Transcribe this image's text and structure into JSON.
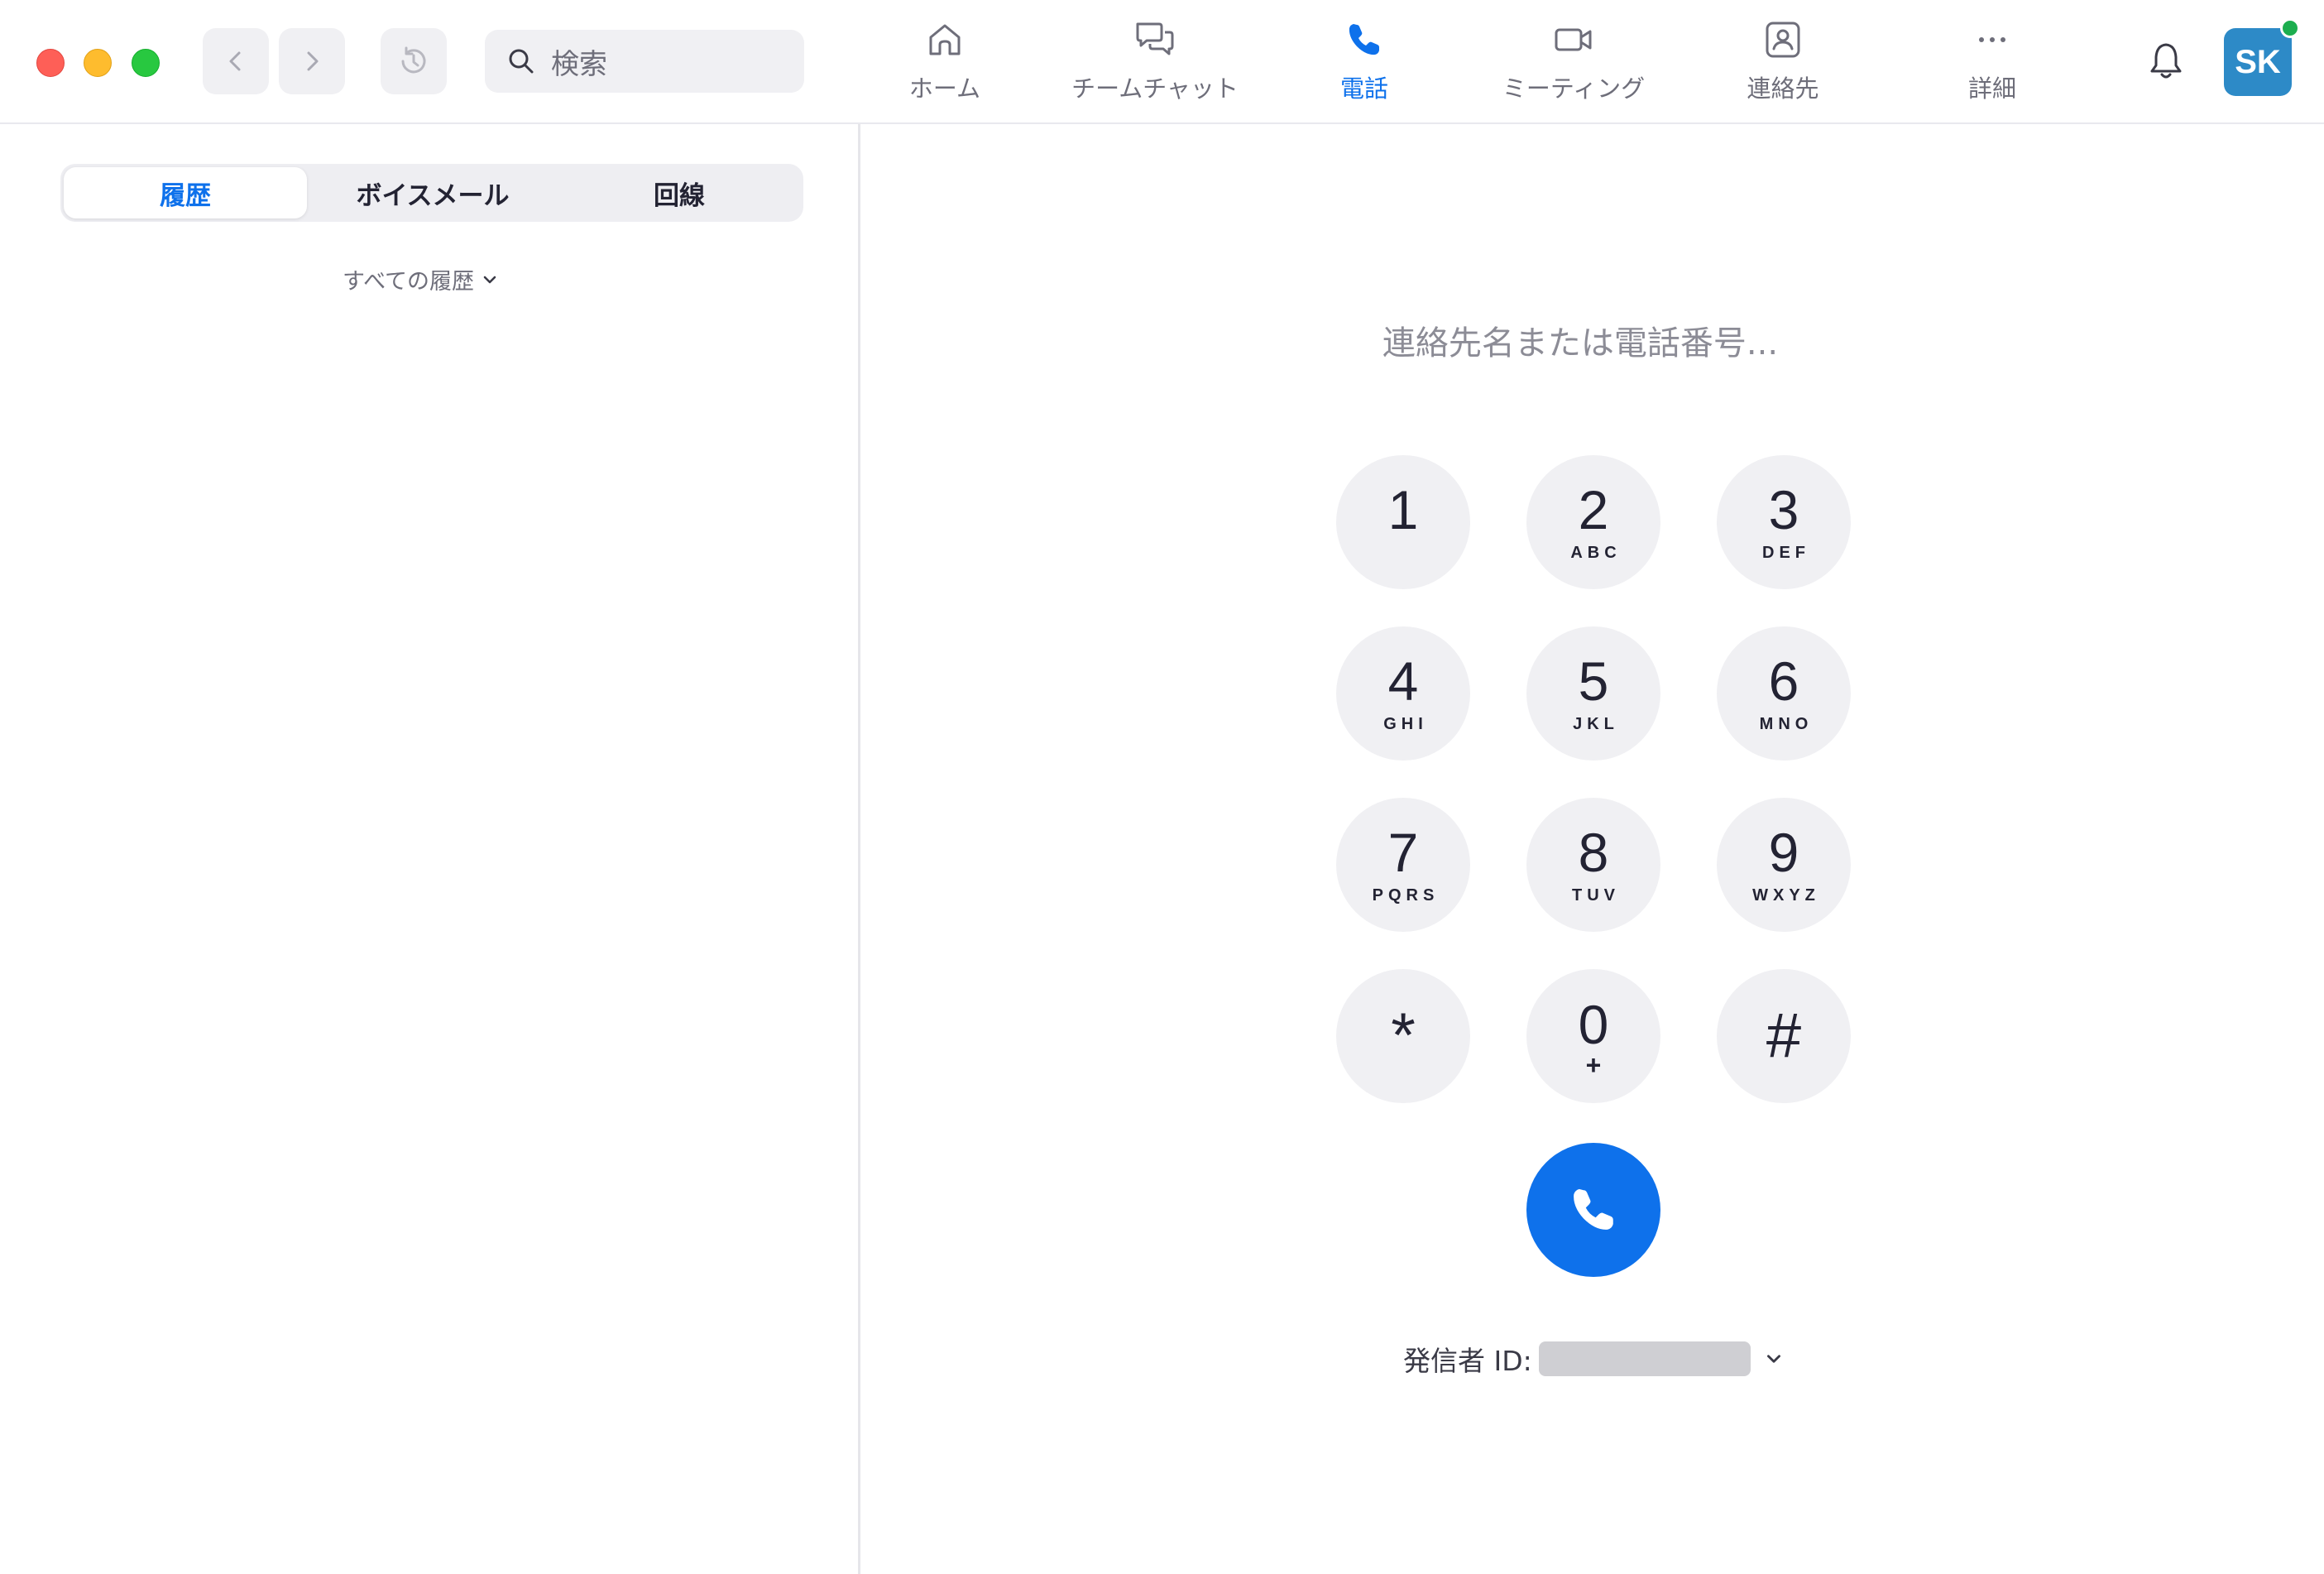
{
  "search": {
    "placeholder": "検索",
    "icon": "search-icon"
  },
  "tabs": [
    {
      "label": "ホーム",
      "icon": "home-icon",
      "active": false
    },
    {
      "label": "チームチャット",
      "icon": "chat-icon",
      "active": false
    },
    {
      "label": "電話",
      "icon": "phone-icon",
      "active": true
    },
    {
      "label": "ミーティング",
      "icon": "video-icon",
      "active": false
    },
    {
      "label": "連絡先",
      "icon": "contacts-icon",
      "active": false
    },
    {
      "label": "詳細",
      "icon": "more-icon",
      "active": false
    }
  ],
  "profile": {
    "initials": "SK",
    "status": "online",
    "avatar_color": "#2d8ac7",
    "status_color": "#1cae4f"
  },
  "left_panel": {
    "segments": [
      "履歴",
      "ボイスメール",
      "回線"
    ],
    "selected_segment": "履歴",
    "filter": "すべての履歴"
  },
  "dialer": {
    "input_placeholder": "連絡先名または電話番号...",
    "keys": [
      {
        "digit": "1",
        "letters": ""
      },
      {
        "digit": "2",
        "letters": "ABC"
      },
      {
        "digit": "3",
        "letters": "DEF"
      },
      {
        "digit": "4",
        "letters": "GHI"
      },
      {
        "digit": "5",
        "letters": "JKL"
      },
      {
        "digit": "6",
        "letters": "MNO"
      },
      {
        "digit": "7",
        "letters": "PQRS"
      },
      {
        "digit": "8",
        "letters": "TUV"
      },
      {
        "digit": "9",
        "letters": "WXYZ"
      },
      {
        "digit": "*",
        "letters": ""
      },
      {
        "digit": "0",
        "letters": "+"
      },
      {
        "digit": "#",
        "letters": ""
      }
    ],
    "caller_id_label": "発信者 ID:",
    "call_button_color": "#0e71eb"
  },
  "colors": {
    "accent": "#0e71eb",
    "key_bg": "#f0f0f3"
  }
}
